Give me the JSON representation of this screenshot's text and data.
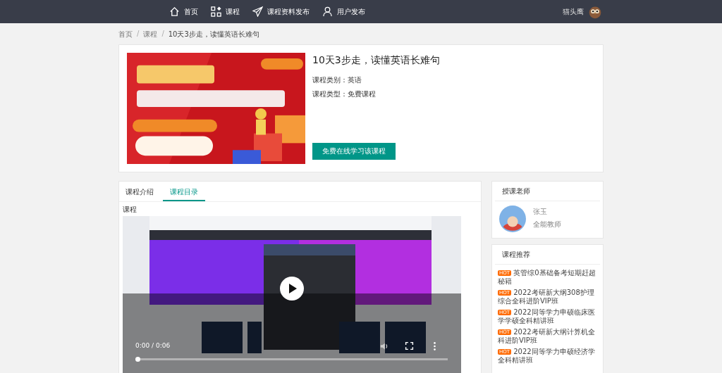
{
  "nav": {
    "items": [
      {
        "label": "首页"
      },
      {
        "label": "课程"
      },
      {
        "label": "课程资料发布"
      },
      {
        "label": "用户发布"
      }
    ],
    "user": "猫头鹰"
  },
  "breadcrumb": {
    "separator": "/",
    "items": [
      "首页",
      "课程",
      "10天3步走，读懂英语长难句"
    ]
  },
  "course": {
    "title": "10天3步走，读懂英语长难句",
    "meta": [
      "课程类别：英语",
      "课程类型：免费课程"
    ],
    "button": "免费在线学习该课程"
  },
  "tabs": [
    {
      "label": "课程介绍",
      "selected": false
    },
    {
      "label": "课程目录",
      "selected": true
    }
  ],
  "section_title": "课程",
  "video": {
    "time": "0:00 / 0:06",
    "level": 0.0
  },
  "teacher": {
    "heading": "授课老师",
    "name": "张玉",
    "role": "全能教师"
  },
  "recommend": {
    "heading": "课程推荐",
    "items": [
      {
        "badge": "HOT",
        "title": "英管综0基础备考短期赶超秘籍"
      },
      {
        "badge": "HOT",
        "title": "2022考研新大纲308护理综合全科进阶VIP班"
      },
      {
        "badge": "HOT",
        "title": "2022同等学力申硕临床医学学硕全科精讲班"
      },
      {
        "badge": "HOT",
        "title": "2022考研新大纲计算机全科进阶VIP班"
      },
      {
        "badge": "HOT",
        "title": "2022同等学力申硕经济学全科精讲班"
      }
    ]
  }
}
